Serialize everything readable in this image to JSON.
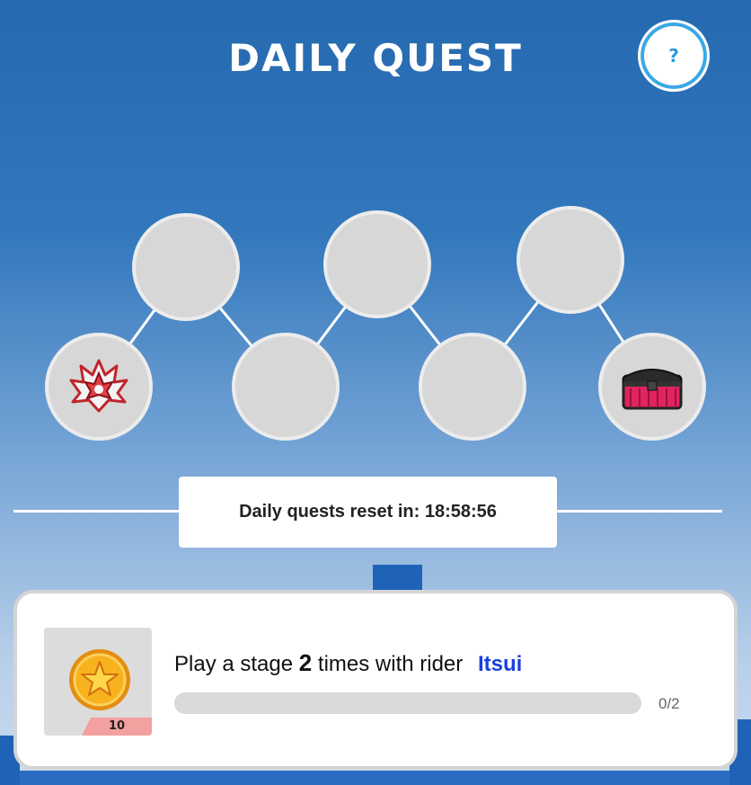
{
  "header": {
    "title": "DAILY QUEST",
    "help_label": "?"
  },
  "quest_path": {
    "nodes": [
      {
        "id": 1,
        "reward_icon": "flame-crest-icon"
      },
      {
        "id": 2,
        "reward_icon": null
      },
      {
        "id": 3,
        "reward_icon": null
      },
      {
        "id": 4,
        "reward_icon": null
      },
      {
        "id": 5,
        "reward_icon": null
      },
      {
        "id": 6,
        "reward_icon": null
      },
      {
        "id": 7,
        "reward_icon": "treasure-chest-icon"
      }
    ]
  },
  "timer": {
    "label": "Daily quests reset in: 18:58:56"
  },
  "quest": {
    "text_prefix": "Play a stage",
    "count": "2",
    "text_middle": "times with rider",
    "rider": "Itsui",
    "reward_icon": "star-coin-icon",
    "reward_amount": "10",
    "progress_label": "0/2",
    "progress_fraction": 0
  },
  "colors": {
    "accent_blue": "#1a3fe0",
    "help_ring": "#3aa8e4",
    "node_fill": "#d7d7d7",
    "reward_badge": "#f2a0a0"
  }
}
